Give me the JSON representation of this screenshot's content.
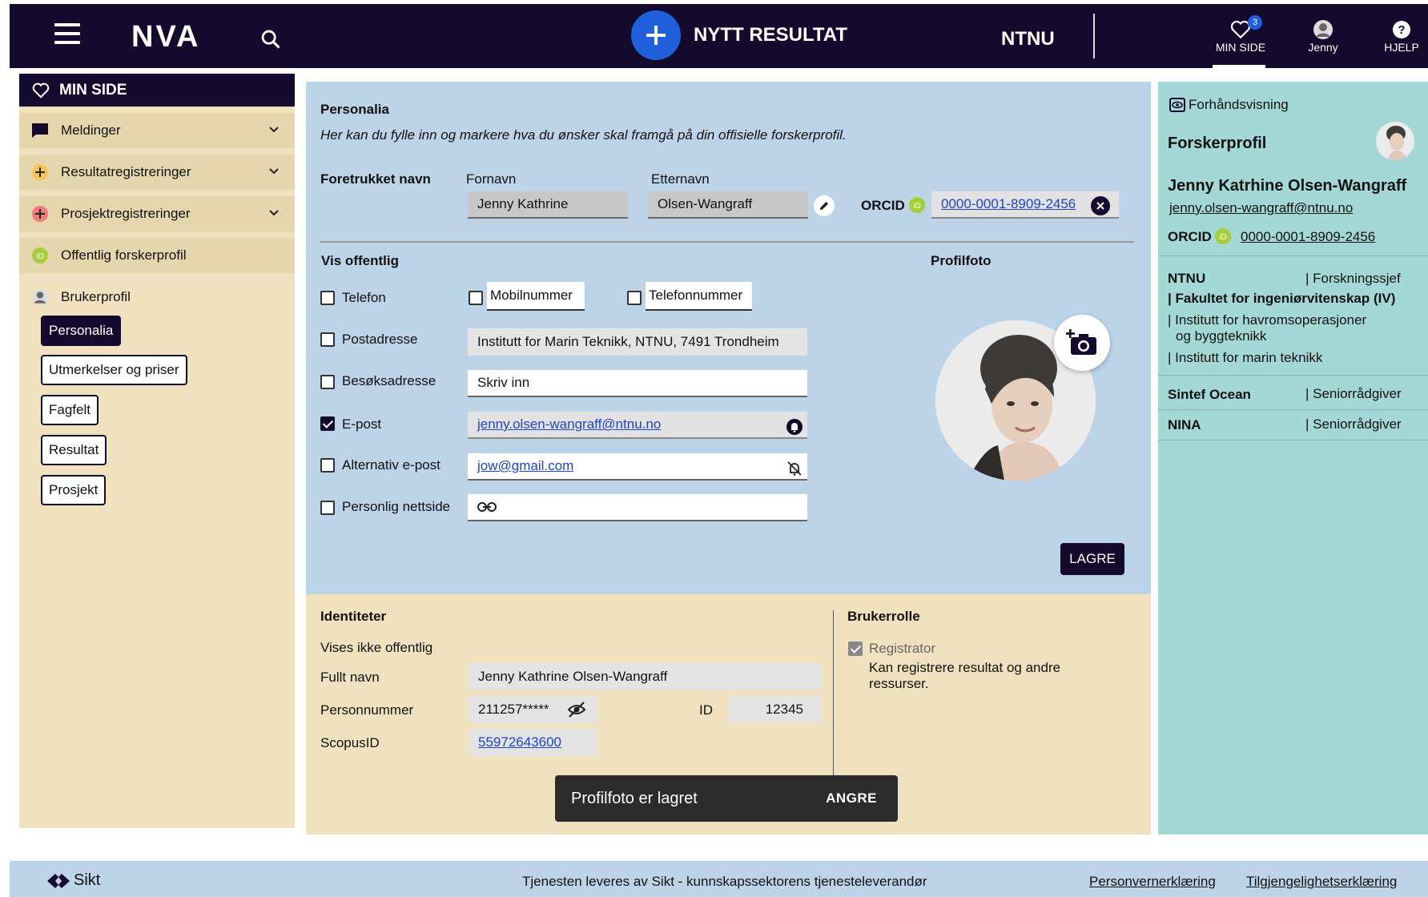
{
  "header": {
    "logo": "NVA",
    "new_result": "NYTT RESULTAT",
    "org": "NTNU",
    "min_side": "MIN SIDE",
    "min_side_badge": "3",
    "user": "Jenny",
    "help": "HJELP"
  },
  "sidebar": {
    "title": "MIN SIDE",
    "items": [
      {
        "label": "Meldinger"
      },
      {
        "label": "Resultatregistreringer"
      },
      {
        "label": "Prosjektregistreringer"
      },
      {
        "label": "Offentlig forskerprofil"
      },
      {
        "label": "Brukerprofil"
      }
    ],
    "sub_items": [
      "Personalia",
      "Utmerkelser og priser",
      "Fagfelt",
      "Resultat",
      "Prosjekt"
    ]
  },
  "personalia": {
    "title": "Personalia",
    "intro": "Her kan du fylle inn og markere hva du ønsker skal framgå på din offisielle forskerprofil.",
    "preferred_name_label": "Foretrukket navn",
    "first_name_label": "Fornavn",
    "first_name": "Jenny Kathrine",
    "last_name_label": "Etternavn",
    "last_name": "Olsen-Wangraff",
    "orcid_label": "ORCID",
    "orcid": "0000-0001-8909-2456",
    "vis_offentlig": "Vis offentlig",
    "profile_photo": "Profilfoto",
    "telefon": "Telefon",
    "mobil": "Mobilnummer",
    "telefonnummer": "Telefonnummer",
    "postadresse": "Postadresse",
    "postadresse_value": "Institutt for Marin Teknikk, NTNU, 7491 Trondheim",
    "besoksadresse": "Besøksadresse",
    "besoksadresse_placeholder": "Skriv inn",
    "epost": "E-post",
    "epost_value": "jenny.olsen-wangraff@ntnu.no",
    "alt_epost": "Alternativ e-post",
    "alt_epost_value": "jow@gmail.com",
    "nettside": "Personlig nettside",
    "save": "LAGRE"
  },
  "identiteter": {
    "title": "Identiteter",
    "not_public": "Vises ikke offentlig",
    "full_name_label": "Fullt navn",
    "full_name": "Jenny Kathrine Olsen-Wangraff",
    "pnr_label": "Personnummer",
    "pnr": "211257*****",
    "id_label": "ID",
    "id": "12345",
    "scopus_label": "ScopusID",
    "scopus": "55972643600"
  },
  "brukerrolle": {
    "title": "Brukerrolle",
    "role": "Registrator",
    "role_desc": "Kan registrere resultat og andre ressurser."
  },
  "snackbar": {
    "message": "Profilfoto er lagret",
    "action": "ANGRE"
  },
  "preview": {
    "title": "Forhåndsvisning",
    "heading": "Forskerprofil",
    "name": "Jenny Katrhine Olsen-Wangraff",
    "email": "jenny.olsen-wangraff@ntnu.no",
    "orcid_label": "ORCID",
    "orcid": "0000-0001-8909-2456",
    "aff1_org": "NTNU",
    "aff1_role": "| Forskningssjef",
    "aff1_l1": "| Fakultet for ingeniørvitenskap (IV)",
    "aff1_l2a": "| Institutt for havromsoperasjoner",
    "aff1_l2b": "og byggteknikk",
    "aff1_l3": "| Institutt for marin teknikk",
    "aff2_org": "Sintef Ocean",
    "aff2_role": "| Seniorrådgiver",
    "aff3_org": "NINA",
    "aff3_role": "| Seniorrådgiver"
  },
  "footer": {
    "brand": "Sikt",
    "text": "Tjenesten leveres av Sikt - kunnskapssektorens tjenesteleverandør",
    "privacy": "Personvernerklæring",
    "accessibility": "Tilgjengelighetserklæring"
  },
  "colors": {
    "navy": "#130a2e",
    "accent_blue": "#1f5fdc",
    "sand": "#f0e2bf",
    "light_blue": "#bcd3e8",
    "teal": "#a3d8d6",
    "orcid_green": "#a6ce39"
  }
}
